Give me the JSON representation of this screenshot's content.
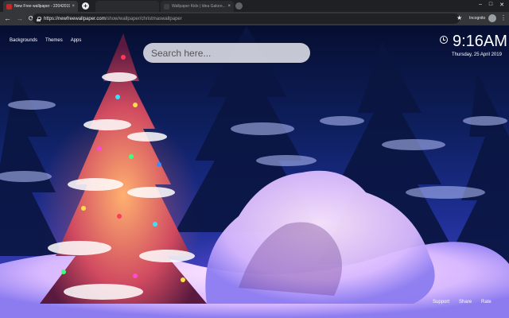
{
  "browser": {
    "tabs": [
      {
        "title": "New Free wallpaper - 22042019...",
        "close": "×",
        "active": true
      },
      {
        "title": "Wallpaper Kids | Idea Galore...",
        "close": "×",
        "active": false
      }
    ],
    "new_tab": "+",
    "window_controls": {
      "minimize": "–",
      "maximize": "□",
      "close": "✕"
    },
    "nav": {
      "back": "←",
      "forward": "→",
      "reload": "⟳"
    },
    "url_host": "https://newfreewallpaper.com",
    "url_path": "/show/wallpaper/christmaswallpaper",
    "bookmark_star": "★",
    "profile_label": "Incognito",
    "menu": "⋮"
  },
  "page": {
    "nav_links": [
      "Backgrounds",
      "Themes",
      "Apps"
    ],
    "search_placeholder": "Search here...",
    "clock": {
      "time": "9:16",
      "ampm": "AM",
      "date": "Thursday, 25 April 2019"
    },
    "footer_links": [
      "Support",
      "Share",
      "Rate"
    ]
  },
  "colors": {
    "tabstrip": "#1f2023",
    "toolbar": "#35363a",
    "omnibox": "#202124",
    "sky": "#0e1f5e",
    "snow": "#f2e0ff"
  }
}
